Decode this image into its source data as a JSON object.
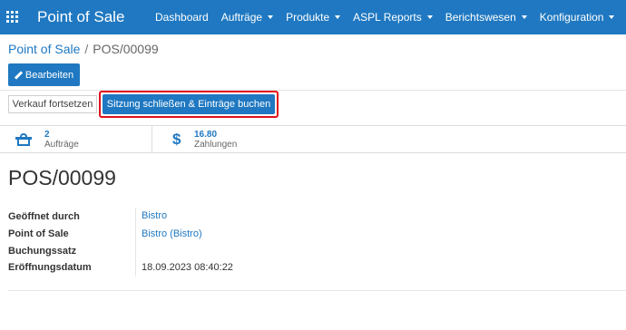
{
  "navbar": {
    "brand": "Point of Sale",
    "menu": [
      {
        "label": "Dashboard",
        "has_caret": false
      },
      {
        "label": "Aufträge",
        "has_caret": true
      },
      {
        "label": "Produkte",
        "has_caret": true
      },
      {
        "label": "ASPL Reports",
        "has_caret": true
      },
      {
        "label": "Berichtswesen",
        "has_caret": true
      },
      {
        "label": "Konfiguration",
        "has_caret": true
      }
    ],
    "color": "#1f78c1"
  },
  "breadcrumb": {
    "parent": "Point of Sale",
    "separator": "/",
    "current": "POS/00099"
  },
  "actions": {
    "edit_label": "Bearbeiten",
    "resume_label": "Verkauf fortsetzen",
    "close_label": "Sitzung schließen & Einträge buchen",
    "highlight_color": "#e0101a"
  },
  "stats": {
    "orders": {
      "value": "2",
      "label": "Aufträge",
      "icon": "basket-icon"
    },
    "payments": {
      "value": "16.80",
      "label": "Zahlungen",
      "icon": "dollar-icon"
    }
  },
  "record": {
    "title": "POS/00099",
    "fields": [
      {
        "label": "Geöffnet durch",
        "value": "Bistro",
        "is_link": true
      },
      {
        "label": "Point of Sale",
        "value": "Bistro (Bistro)",
        "is_link": true
      },
      {
        "label": "Buchungssatz",
        "value": "",
        "is_link": false
      },
      {
        "label": "Eröffnungsdatum",
        "value": "18.09.2023 08:40:22",
        "is_link": false
      }
    ]
  }
}
